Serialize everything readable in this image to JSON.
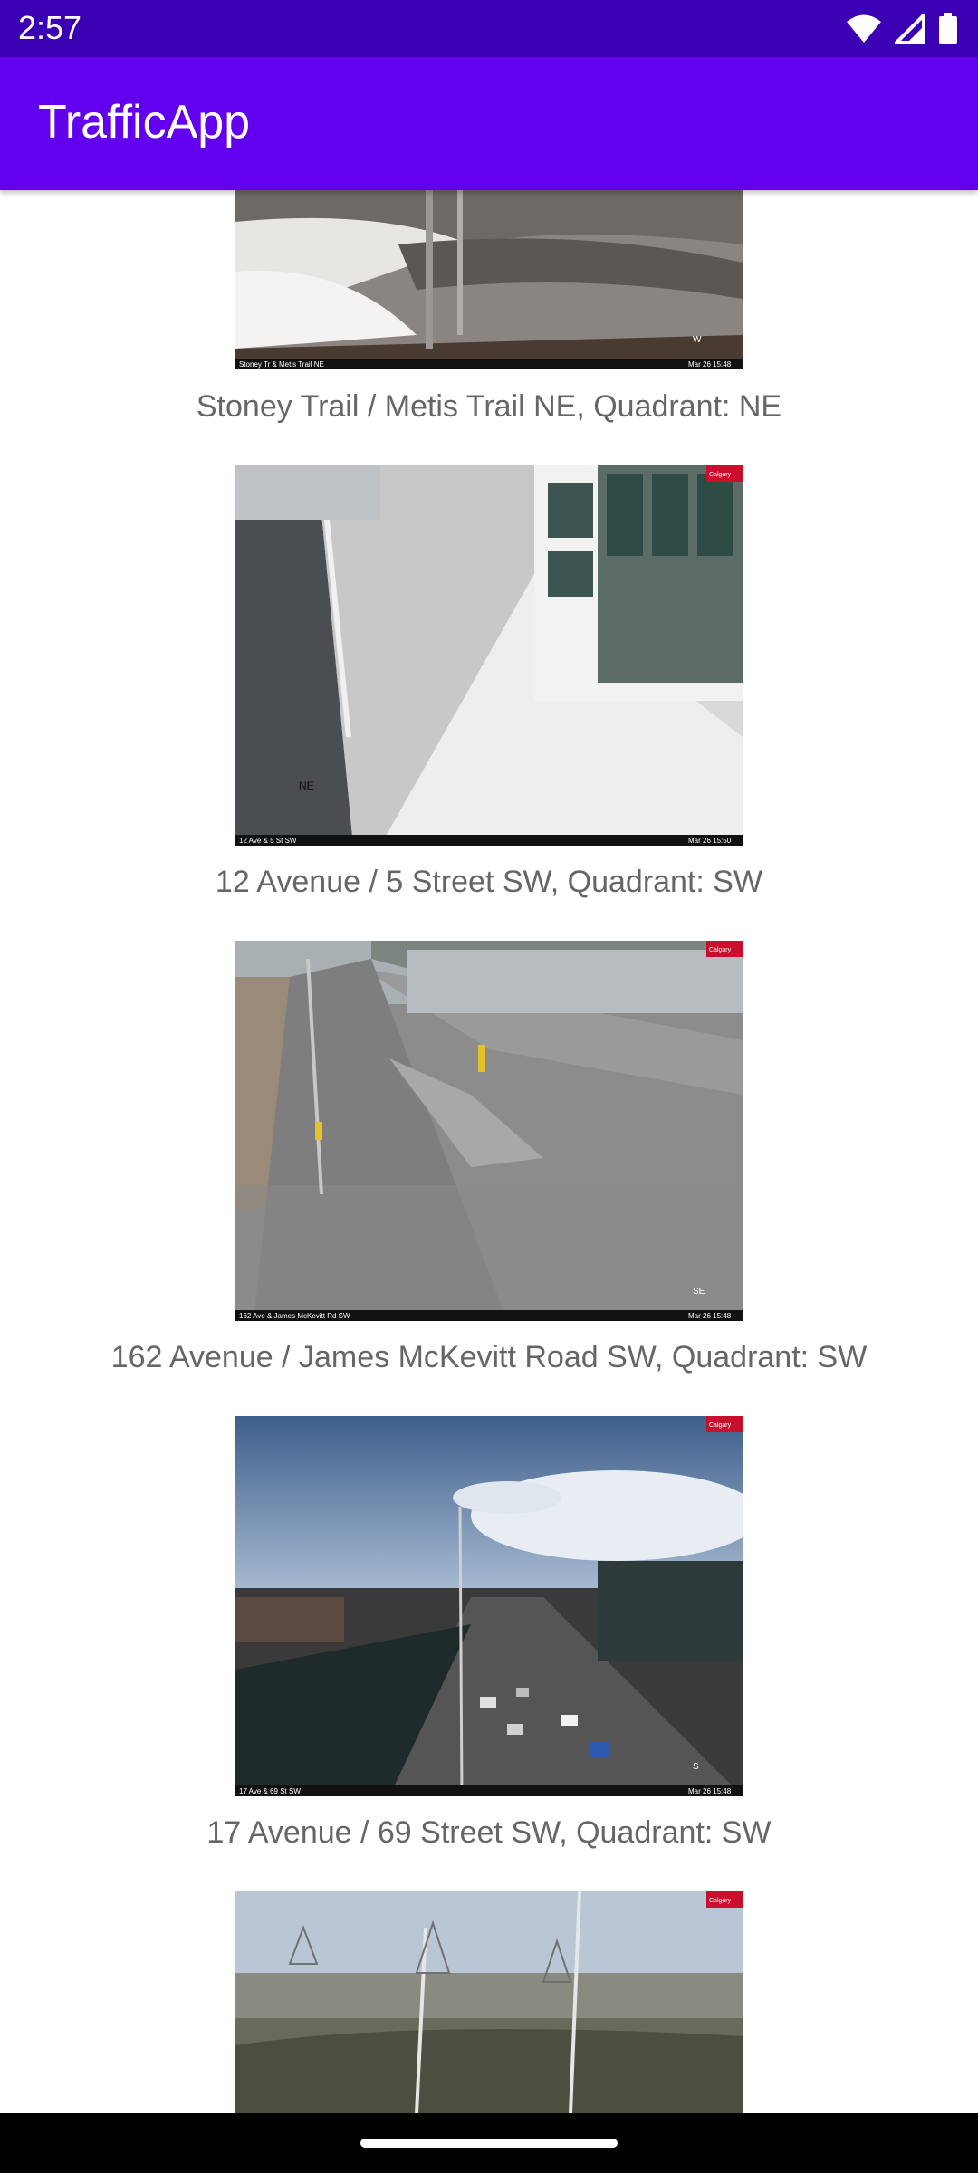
{
  "status_bar": {
    "time": "2:57",
    "icons": [
      "wifi-icon",
      "cell-signal-icon",
      "battery-icon"
    ]
  },
  "app_bar": {
    "title": "TrafficApp",
    "color": "#6200ee"
  },
  "cameras": [
    {
      "caption": "Stoney Trail / Metis Trail NE, Quadrant: NE",
      "overlay_location": "Stoney Tr & Metis Trail NE",
      "overlay_timestamp": "Mar 26 15:48",
      "overlay_direction": "W"
    },
    {
      "caption": "12 Avenue / 5 Street SW, Quadrant: SW",
      "overlay_location": "12 Ave & 5 St SW",
      "overlay_timestamp": "Mar 26 15:50",
      "overlay_direction": "NE"
    },
    {
      "caption": "162 Avenue / James McKevitt Road SW, Quadrant: SW",
      "overlay_location": "162 Ave & James McKevitt Rd SW",
      "overlay_timestamp": "Mar 26 15:48",
      "overlay_direction": "SE"
    },
    {
      "caption": "17 Avenue / 69 Street SW, Quadrant: SW",
      "overlay_location": "17 Ave & 69 St SW",
      "overlay_timestamp": "Mar 26 15:48",
      "overlay_direction": "S"
    },
    {
      "caption": "",
      "overlay_location": "",
      "overlay_timestamp": "",
      "overlay_direction": ""
    }
  ],
  "logo_text": "Calgary"
}
